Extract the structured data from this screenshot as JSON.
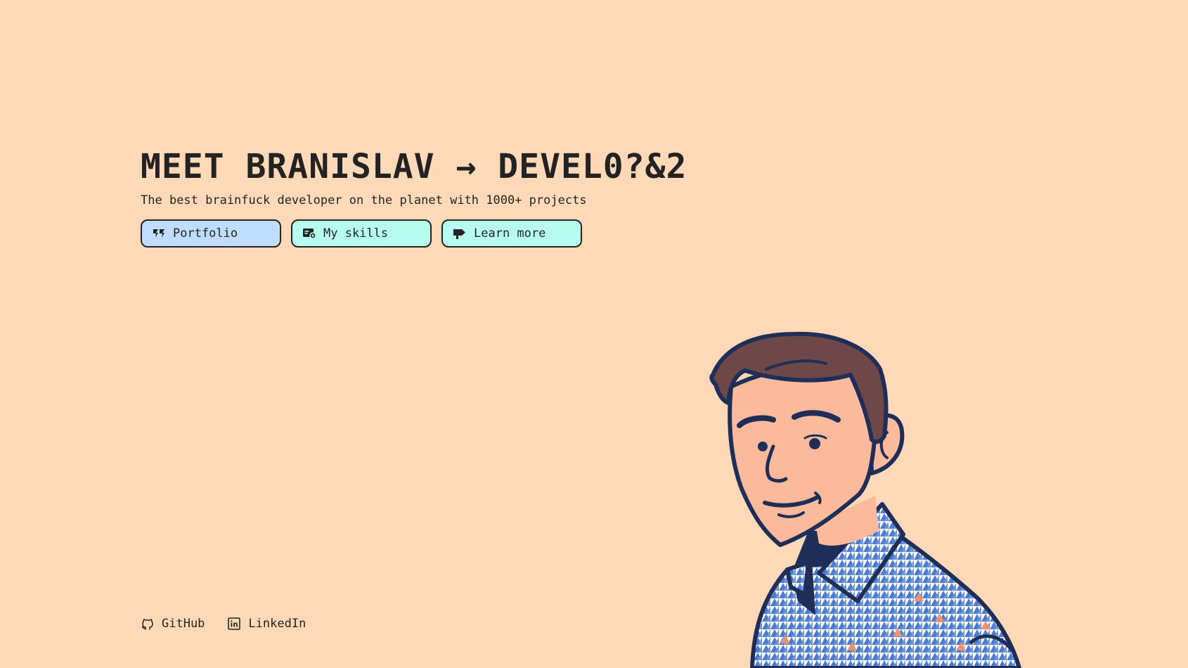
{
  "hero": {
    "title": "MEET BRANISLAV → DEVEL0?&2",
    "subtitle": "The best brainfuck developer on the planet with 1000+ projects"
  },
  "buttons": [
    {
      "label": "Portfolio",
      "icon": "portfolio-icon",
      "color": "#BFDDFE"
    },
    {
      "label": "My skills",
      "icon": "skills-icon",
      "color": "#B6FDF0"
    },
    {
      "label": "Learn more",
      "icon": "signpost-icon",
      "color": "#B6FDF0"
    }
  ],
  "social": [
    {
      "label": "GitHub",
      "icon": "github-icon"
    },
    {
      "label": "LinkedIn",
      "icon": "linkedin-icon"
    }
  ],
  "colors": {
    "background": "#FFD9B8",
    "text": "#232323",
    "outline": "#1F2E57",
    "skin": "#FCBA9C",
    "hair": "#6E4848",
    "shirt_blue": "#4C7BD0"
  }
}
